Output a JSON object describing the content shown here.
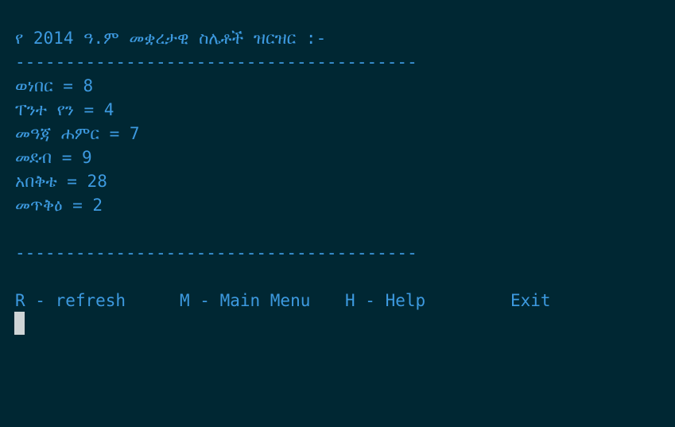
{
  "terminal": {
    "title": "የ 2014 ዓ.ም መቋረታዊ ስሌቶች ዝርዝር :-",
    "separator_top": "----------------------------------------",
    "items": [
      {
        "text": "ወነበር = 8"
      },
      {
        "text": "ፐንተ የን = 4"
      },
      {
        "text": "መዓጃ ሐምር = 7"
      },
      {
        "text": "መደብ = 9"
      },
      {
        "text": "አበቅቴ = 28"
      },
      {
        "text": "መጥቅዕ = 2"
      }
    ],
    "separator_bottom": "----------------------------------------",
    "menu": {
      "refresh": "R - refresh",
      "main_menu": "M - Main Menu",
      "help": "H - Help",
      "exit": "Exit"
    }
  },
  "colors": {
    "background": "#002733",
    "text": "#3d9ae0",
    "cursor": "#cfd4d6"
  }
}
